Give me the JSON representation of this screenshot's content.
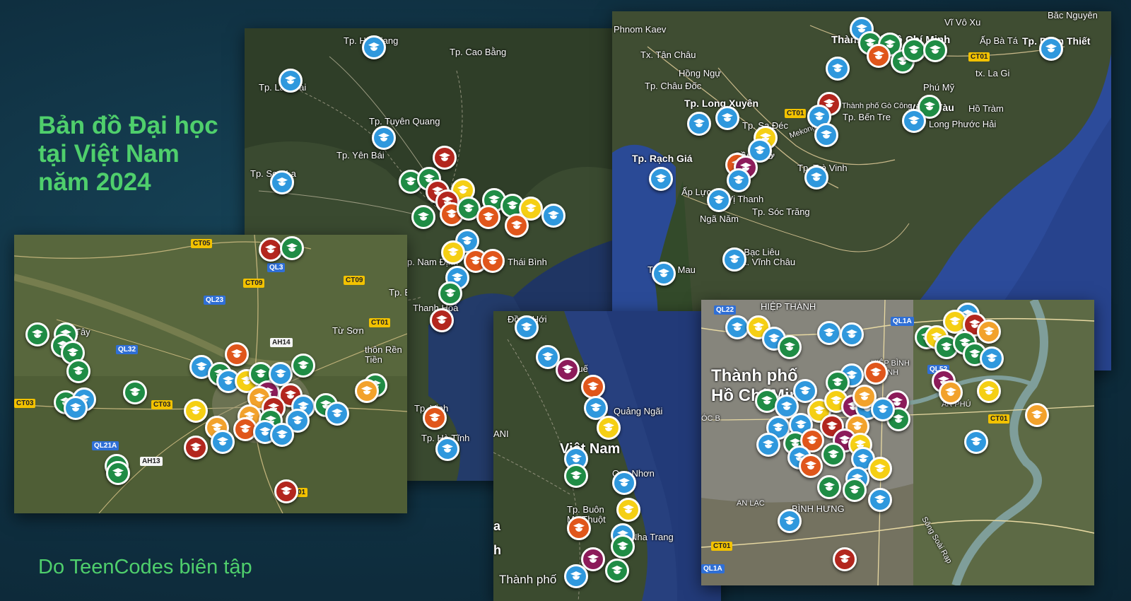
{
  "title_lines": [
    "Bản đồ Đại học",
    "tại Việt Nam",
    "năm 2024"
  ],
  "credit": "Do TeenCodes biên tập",
  "pin_icon": "graduation-cap-icon",
  "colors": {
    "title": "#4fcf6c",
    "blue": "#2f98dd",
    "green": "#1f8c45",
    "red": "#b3261e",
    "orange": "#e0561b",
    "yellow": "#f5cf14",
    "amber": "#f2a22c",
    "purple": "#8c1b5a"
  },
  "maps": {
    "north": {
      "place_labels": [
        "Tp. Hà Giang",
        "Tp. Cao Bằng",
        "Tp. Lào Cai",
        "Tp. Tuyên Quang",
        "Tp. Yên Bái",
        "Tp. Sơn La",
        "Tp. Nam Định",
        "Tp. Thái Bình",
        "Thanh Hoá",
        "Tp. Vinh",
        "Tp. Hà Tĩnh"
      ]
    },
    "mekong": {
      "place_labels": [
        "Phnom Kaev",
        "Tx. Tân Châu",
        "Hồng Ngự",
        "Tp. Châu Đốc",
        "Tp. Long Xuyên",
        "Tp. Sa Đéc",
        "Tp. Rạch Giá",
        "Cần Thơ",
        "Tp. Trà Vinh",
        "Tp. Vị Thanh",
        "Tp. Sóc Trăng",
        "Ngã Năm",
        "Tp. Bạc Liêu",
        "Tx. Vĩnh Châu",
        "Tp. Cà Mau",
        "Thành phố Hồ Chí Minh",
        "Tp. Bến Tre",
        "Tp. Phan Thiết",
        "Vũng Tàu",
        "Long Phước Hải",
        "Hồ Tràm",
        "Phú Mỹ",
        "Bắc Nguyên",
        "Vĩ Vô Xu",
        "Ấp Bà Tá",
        "Ấp Lực",
        "Mekong",
        "tx. La Gi",
        "Tp. Thành phố Gò Công"
      ],
      "road_labels": [
        "CT01",
        "CT01"
      ]
    },
    "hanoi": {
      "place_labels": [
        "Tây",
        "Từ Sơn",
        "thôn Rền Tiền",
        "Tp. B"
      ],
      "road_labels": [
        "CT05",
        "QL3",
        "CT09",
        "CT09",
        "QL23",
        "CT01",
        "AH14",
        "QL32",
        "CT03",
        "CT03",
        "QL21A",
        "AH13",
        "01"
      ]
    },
    "central": {
      "place_labels": [
        "Đồng Hới",
        "Huế",
        "Quảng Ngãi",
        "Việt Nam",
        "Quy Nhơn",
        "Tp. Buôn Ma Thuột",
        "Nha Trang",
        "Thành phố",
        "ANI",
        "a",
        "h"
      ]
    },
    "hcm": {
      "place_labels": [
        "HIỆP THÀNH",
        "Thành phố Hồ Chí Minh",
        "HIỆP BÌNH CHÁNH",
        "AN PHÚ",
        "ÓC B",
        "AN LẠC",
        "BÌNH HƯNG",
        "Sông Soài Rạp"
      ],
      "road_labels": [
        "QL22",
        "QL1A",
        "QL52",
        "CT01",
        "CT01",
        "QL1A"
      ]
    }
  }
}
